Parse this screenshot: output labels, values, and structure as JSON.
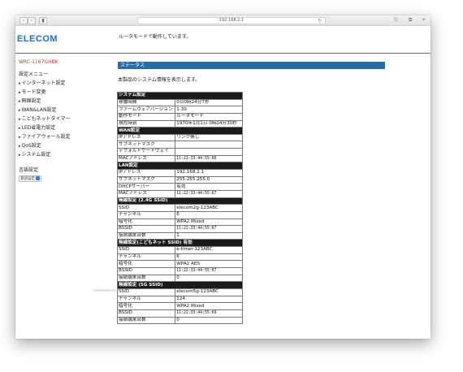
{
  "browser": {
    "url": "192.168.2.1",
    "back_icon": "chevron-left-icon",
    "forward_icon": "chevron-right-icon",
    "sidebar_icon": "sidebar-icon",
    "share_icon": "share-icon",
    "tabs_icon": "tabs-icon"
  },
  "header": {
    "logo": "ELECOM",
    "mode_message": "ルータモードで動作しています。"
  },
  "sidebar": {
    "model": "WRC-1167GHBK",
    "menu_title": "設定メニュー",
    "items": [
      "インターネット設定",
      "モード変更",
      "無線設定",
      "WAN&LAN設定",
      "こどもネットタイマー",
      "LED省電力設定",
      "ファイアウォール設定",
      "QoS設定",
      "システム設定"
    ],
    "language_title": "言語設定",
    "language_value": "意語設定"
  },
  "main": {
    "section_title": "ステータス",
    "description": "本製品のシステム情報を表示します。",
    "rows": [
      {
        "type": "section",
        "label": "システム設定"
      },
      {
        "k": "稼働時間",
        "v": "0日0時24分7秒"
      },
      {
        "k": "ファームウェアバージョン",
        "v": "1.30"
      },
      {
        "k": "動作モード",
        "v": "ルータモード"
      },
      {
        "k": "現在時刻",
        "v": "1970年1月1日 0時24分30秒"
      },
      {
        "type": "section",
        "label": "WAN設定"
      },
      {
        "k": "IPアドレス",
        "v": "リンク無し"
      },
      {
        "k": "サブネットマスク",
        "v": ""
      },
      {
        "k": "デフォルトゲートウェイ",
        "v": ""
      },
      {
        "k": "MACアドレス",
        "v": "11:22:33:44:55:66",
        "mono": true
      },
      {
        "type": "section",
        "label": "LAN設定"
      },
      {
        "k": "IPアドレス",
        "v": "192.168.2.1"
      },
      {
        "k": "サブネットマスク",
        "v": "255.255.255.0"
      },
      {
        "k": "DHCPサーバー",
        "v": "有効"
      },
      {
        "k": "MACアドレス",
        "v": "11:22:33:44:55:67",
        "mono": true
      },
      {
        "type": "section",
        "label": "無線設定 (2.4G SSID)"
      },
      {
        "k": "SSID",
        "v": "elecom2g-123ABC"
      },
      {
        "k": "チャンネル",
        "v": "6"
      },
      {
        "k": "暗号化",
        "v": "WPA2 Mixed"
      },
      {
        "k": "BSSID",
        "v": "11:22:33:44:55:67",
        "mono": true
      },
      {
        "k": "接続端末台数",
        "v": "1"
      },
      {
        "type": "section",
        "label": "無線設定(こどもネット SSID) 有効"
      },
      {
        "k": "SSID",
        "v": "e-timer-123ABC"
      },
      {
        "k": "チャンネル",
        "v": "6"
      },
      {
        "k": "暗号化",
        "v": "WPA2 AES"
      },
      {
        "k": "BSSID",
        "v": "11:22:33:44:55:67",
        "mono": true
      },
      {
        "k": "接続端末台数",
        "v": "0"
      },
      {
        "type": "section",
        "label": "無線設定 (5G SSID)"
      },
      {
        "k": "SSID",
        "v": "elecom5g-123ABC"
      },
      {
        "k": "チャンネル",
        "v": "124"
      },
      {
        "k": "暗号化",
        "v": "WPA2 Mixed"
      },
      {
        "k": "BSSID",
        "v": "11:22:33:44:55:69",
        "mono": true
      },
      {
        "k": "接続端末台数",
        "v": "0"
      }
    ]
  }
}
